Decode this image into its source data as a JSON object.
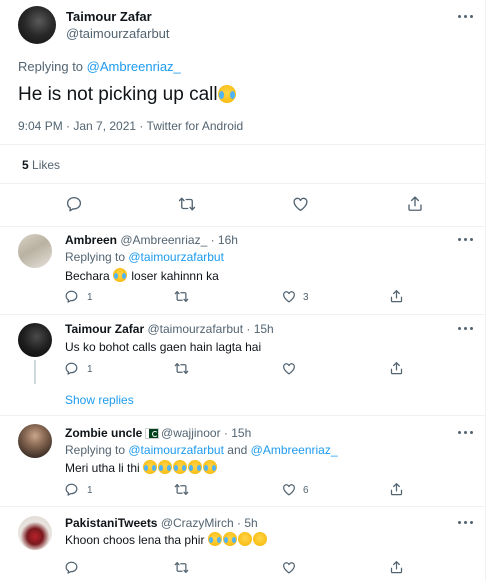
{
  "main_tweet": {
    "name": "Taimour Zafar",
    "handle": "@taimourzafarbut",
    "replying_prefix": "Replying to ",
    "replying_to": "@Ambreenriaz_",
    "text": "He is not picking up call",
    "emoji": "face-with-tears-of-joy",
    "timestamp": "9:04 PM · Jan 7, 2021 · Twitter for Android",
    "likes_count": "5",
    "likes_label": "Likes"
  },
  "replies": [
    {
      "name": "Ambreen",
      "handle": "@Ambreenriaz_",
      "time": "· 16h",
      "replying_prefix": "Replying to ",
      "replying_to": "@taimourzafarbut",
      "text_before": "Bechara",
      "text_after": "loser kahinnn ka",
      "reply_count": "1",
      "retweet_count": "",
      "like_count": "3"
    },
    {
      "name": "Taimour Zafar",
      "handle": "@taimourzafarbut",
      "time": "· 15h",
      "text": "Us ko bohot calls gaen hain lagta hai",
      "reply_count": "1",
      "retweet_count": "",
      "like_count": "",
      "show_replies": "Show replies"
    },
    {
      "name": "Zombie uncle",
      "handle": "@wajjinoor",
      "time": "· 15h",
      "replying_prefix": "Replying to ",
      "replying_to": "@taimourzafarbut",
      "replying_and": " and ",
      "replying_to_2": "@Ambreenriaz_",
      "text": "Meri utha li thi",
      "reply_count": "1",
      "retweet_count": "",
      "like_count": "6"
    },
    {
      "name": "PakistaniTweets",
      "handle": "@CrazyMirch",
      "time": "· 5h",
      "text": "Khoon choos lena tha phir",
      "reply_count": "",
      "retweet_count": "",
      "like_count": ""
    }
  ],
  "colors": {
    "accent": "#1d9bf0",
    "text": "#0f1419",
    "secondary": "#536471",
    "divider": "#eff3f4"
  }
}
